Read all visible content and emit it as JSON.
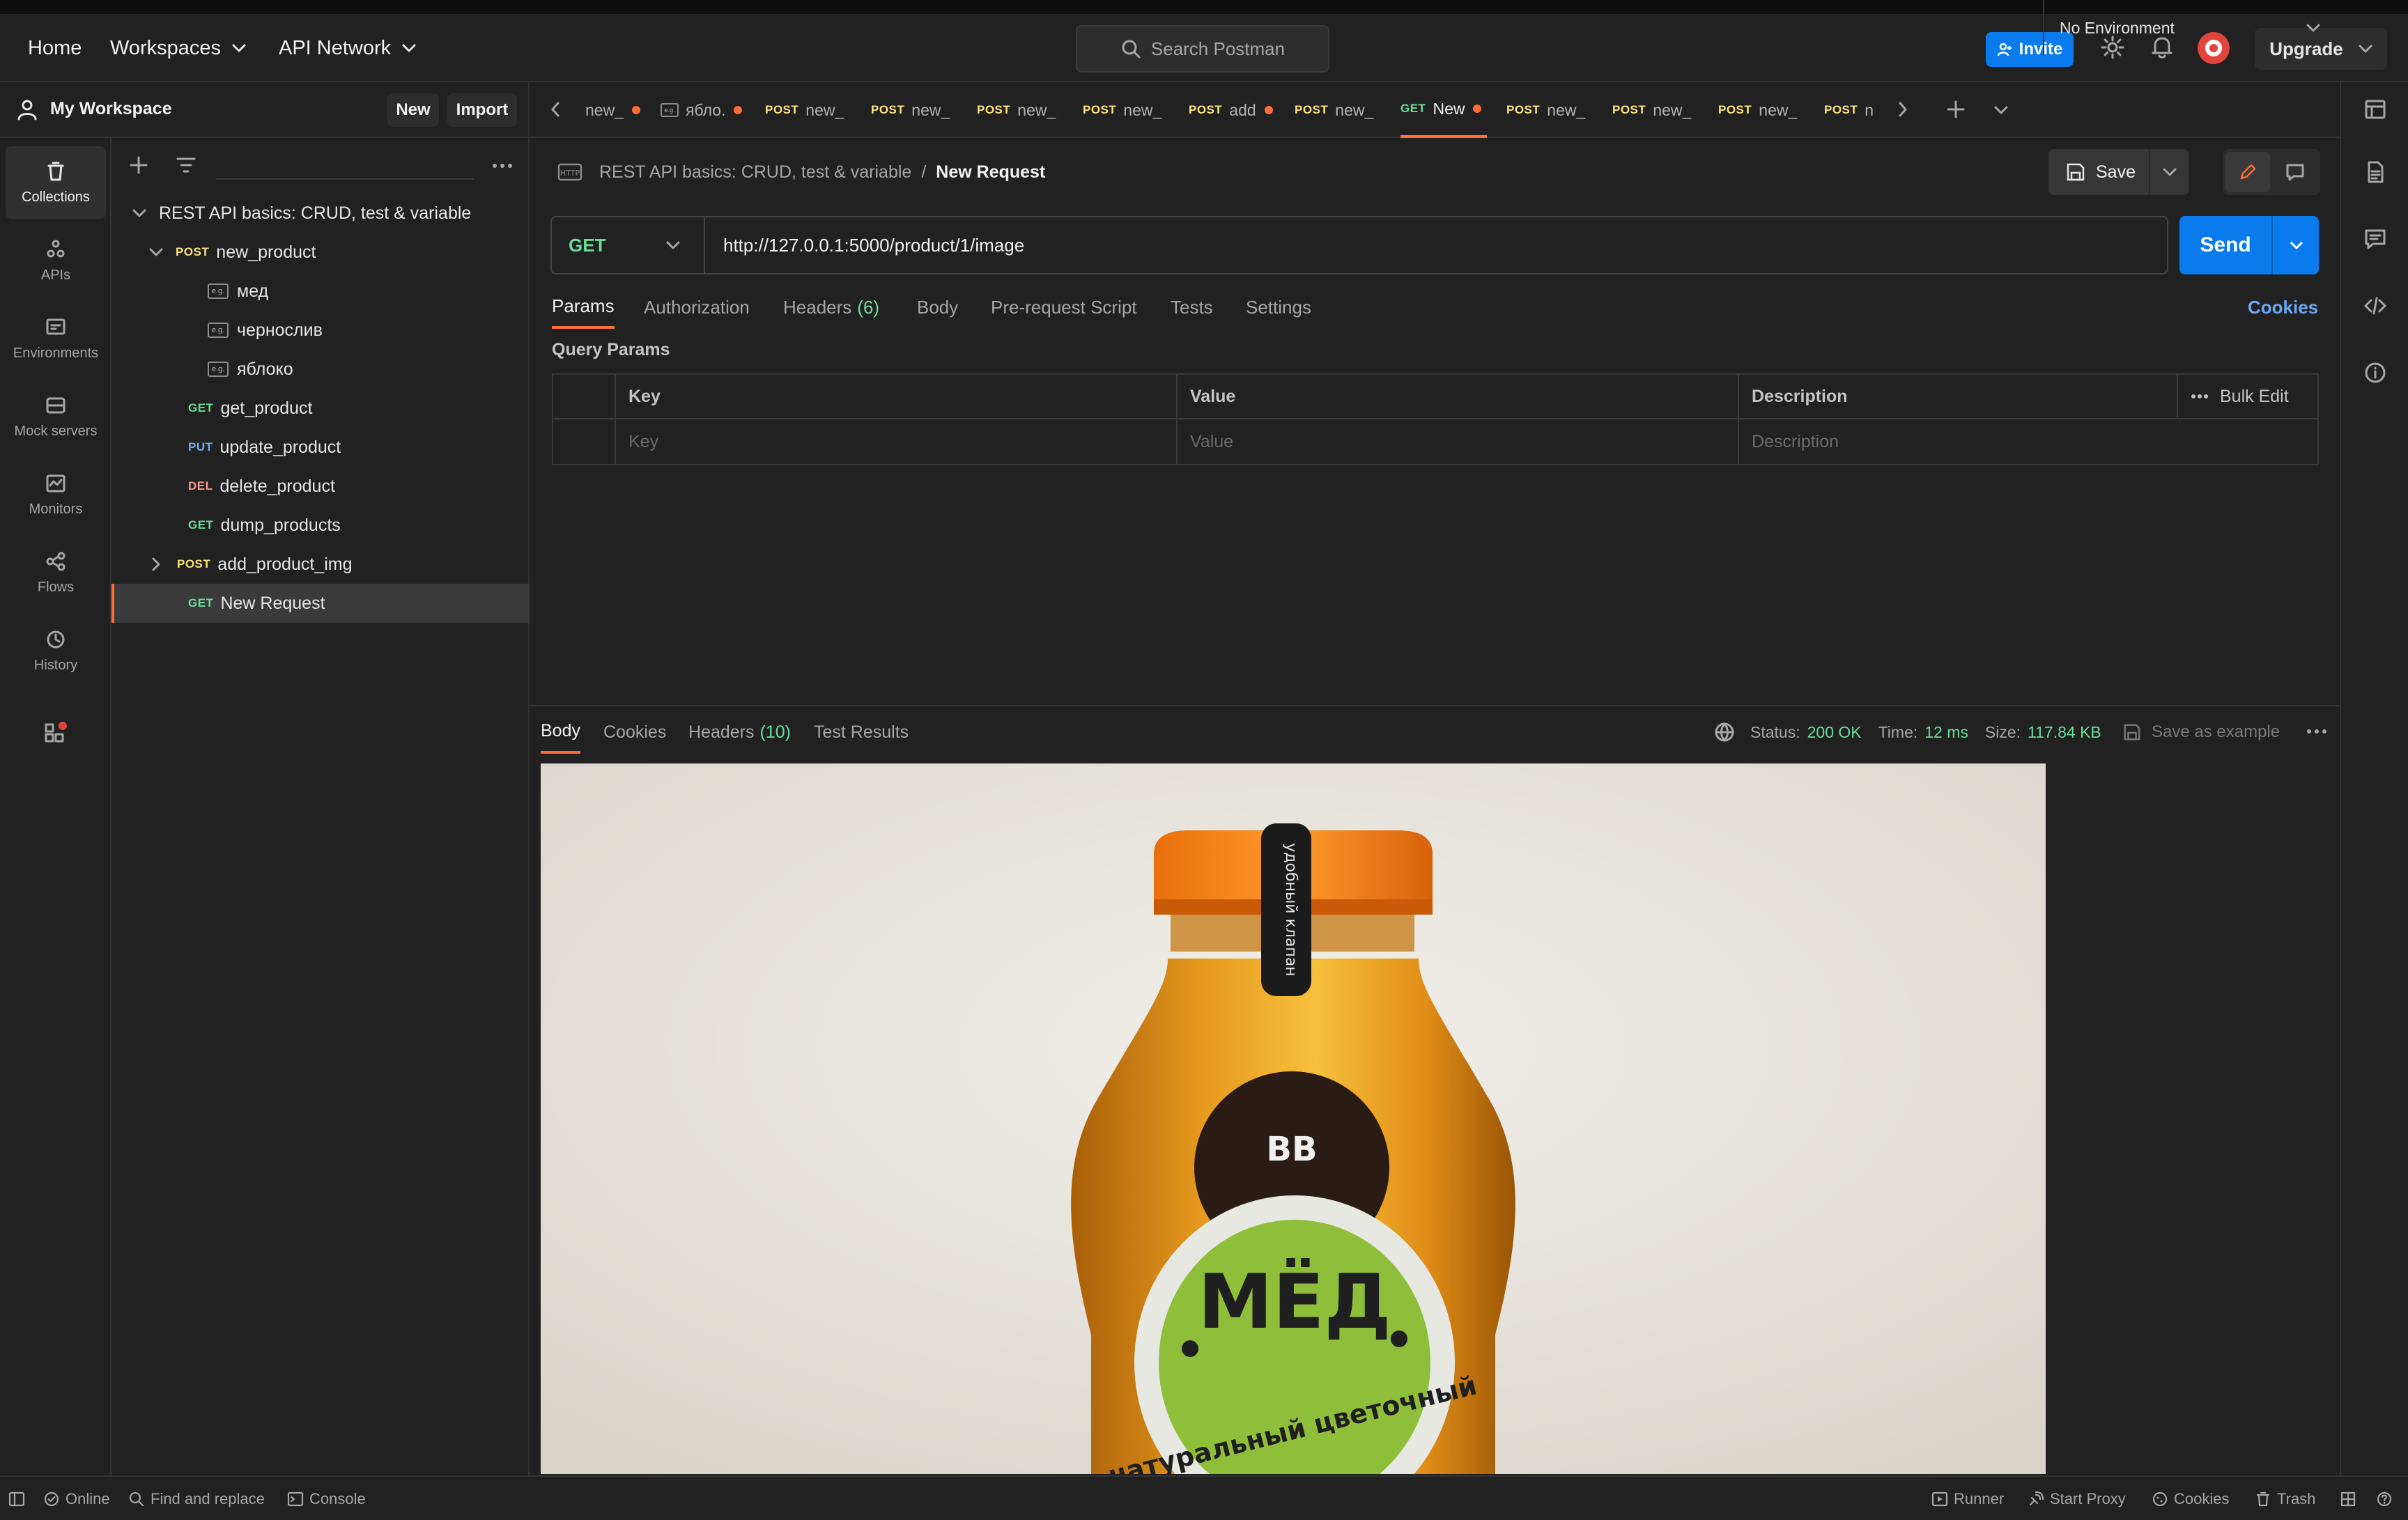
{
  "header": {
    "home": "Home",
    "workspaces": "Workspaces",
    "api_network": "API Network",
    "search_placeholder": "Search Postman",
    "invite": "Invite",
    "upgrade": "Upgrade"
  },
  "workspace": {
    "title": "My Workspace",
    "new_button": "New",
    "import_button": "Import"
  },
  "rail": {
    "items": [
      "Collections",
      "APIs",
      "Environments",
      "Mock servers",
      "Monitors",
      "Flows",
      "History"
    ]
  },
  "tree": {
    "collection": "REST API basics: CRUD, test & variable",
    "new_product": {
      "method": "POST",
      "name": "new_product"
    },
    "examples": [
      "мед",
      "чернослив",
      "яблоко"
    ],
    "requests": [
      {
        "method": "GET",
        "name": "get_product"
      },
      {
        "method": "PUT",
        "name": "update_product"
      },
      {
        "method": "DEL",
        "name": "delete_product"
      },
      {
        "method": "GET",
        "name": "dump_products"
      }
    ],
    "add_product_img": {
      "method": "POST",
      "name": "add_product_img"
    },
    "selected": {
      "method": "GET",
      "name": "New Request"
    }
  },
  "tabs": [
    {
      "method": "",
      "name": "new_"
    },
    {
      "method": "",
      "name": "ябло."
    },
    {
      "method": "POST",
      "name": "new_"
    },
    {
      "method": "POST",
      "name": "new_"
    },
    {
      "method": "POST",
      "name": "new_"
    },
    {
      "method": "POST",
      "name": "new_"
    },
    {
      "method": "POST",
      "name": "add"
    },
    {
      "method": "POST",
      "name": "new_"
    },
    {
      "method": "GET",
      "name": "New"
    },
    {
      "method": "POST",
      "name": "new_"
    },
    {
      "method": "POST",
      "name": "new_"
    },
    {
      "method": "POST",
      "name": "new_"
    },
    {
      "method": "POST",
      "name": "n"
    }
  ],
  "environment": "No Environment",
  "request": {
    "breadcrumb_collection": "REST API basics: CRUD, test & variable",
    "breadcrumb_sep": "/",
    "breadcrumb_current": "New Request",
    "save": "Save",
    "method": "GET",
    "url": "http://127.0.0.1:5000/product/1/image",
    "send": "Send",
    "subtabs": {
      "params": "Params",
      "authorization": "Authorization",
      "headers": "Headers",
      "headers_count": "(6)",
      "body": "Body",
      "prerequest": "Pre-request Script",
      "tests": "Tests",
      "settings": "Settings"
    },
    "cookies": "Cookies",
    "query_params_title": "Query Params",
    "qp_headers": {
      "key": "Key",
      "value": "Value",
      "description": "Description",
      "bulk_edit": "Bulk Edit"
    },
    "qp_placeholders": {
      "key": "Key",
      "value": "Value",
      "description": "Description"
    }
  },
  "response": {
    "tabs": {
      "body": "Body",
      "cookies": "Cookies",
      "headers": "Headers",
      "headers_count": "(10)",
      "test_results": "Test Results"
    },
    "status_label": "Status:",
    "status_value": "200 OK",
    "time_label": "Time:",
    "time_value": "12 ms",
    "size_label": "Size:",
    "size_value": "117.84 KB",
    "save_example": "Save as example",
    "image_texts": {
      "brand": "BB",
      "product": "МЁД",
      "subtitle": "натуральный цветочный",
      "cap_label": "удобный клапан"
    }
  },
  "status_bar": {
    "online": "Online",
    "find_replace": "Find and replace",
    "console": "Console",
    "runner": "Runner",
    "start_proxy": "Start Proxy",
    "cookies": "Cookies",
    "trash": "Trash"
  },
  "colors": {
    "accent": "#ff6c37",
    "primary": "#097bed",
    "get": "#6bdd9a",
    "post": "#ffe47e",
    "put": "#74aef6",
    "del": "#f79a8e"
  }
}
